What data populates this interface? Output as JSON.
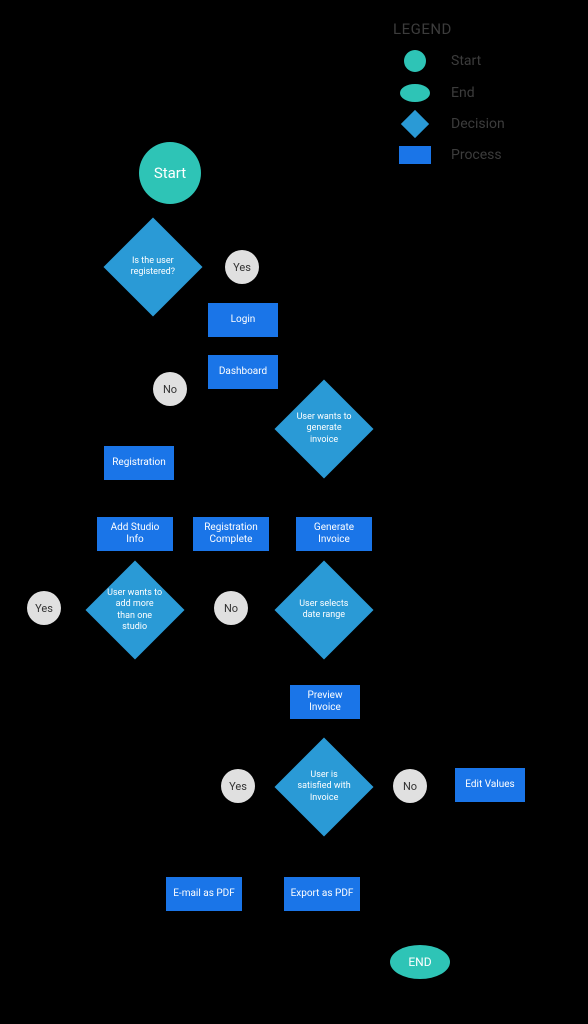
{
  "legend": {
    "title": "LEGEND",
    "items": [
      {
        "label": "Start"
      },
      {
        "label": "End"
      },
      {
        "label": "Decision"
      },
      {
        "label": "Process"
      }
    ]
  },
  "nodes": {
    "start": "Start",
    "d_registered": "Is the user registered?",
    "p_login": "Login",
    "p_dashboard": "Dashboard",
    "d_gen_invoice": "User wants to generate invoice",
    "p_registration": "Registration",
    "p_add_studio": "Add Studio Info",
    "p_reg_complete": "Registration Complete",
    "p_gen_invoice": "Generate Invoice",
    "d_more_studio": "User wants to add more than one studio",
    "d_date_range": "User selects date range",
    "p_preview": "Preview Invoice",
    "d_satisfied": "User is satisfied with Invoice",
    "p_edit_values": "Edit Values",
    "p_email_pdf": "E-mail as PDF",
    "p_export_pdf": "Export as PDF",
    "end": "END"
  },
  "badges": {
    "yes": "Yes",
    "no": "No"
  },
  "chart_data": {
    "type": "flowchart",
    "nodes": [
      {
        "id": "start",
        "type": "start",
        "label": "Start"
      },
      {
        "id": "d_registered",
        "type": "decision",
        "label": "Is the user registered?"
      },
      {
        "id": "p_login",
        "type": "process",
        "label": "Login"
      },
      {
        "id": "p_dashboard",
        "type": "process",
        "label": "Dashboard"
      },
      {
        "id": "d_gen_invoice",
        "type": "decision",
        "label": "User wants to generate invoice"
      },
      {
        "id": "p_registration",
        "type": "process",
        "label": "Registration"
      },
      {
        "id": "p_add_studio",
        "type": "process",
        "label": "Add Studio Info"
      },
      {
        "id": "p_reg_complete",
        "type": "process",
        "label": "Registration Complete"
      },
      {
        "id": "p_gen_invoice",
        "type": "process",
        "label": "Generate Invoice"
      },
      {
        "id": "d_more_studio",
        "type": "decision",
        "label": "User wants to add more than one studio"
      },
      {
        "id": "d_date_range",
        "type": "decision",
        "label": "User selects date range"
      },
      {
        "id": "p_preview",
        "type": "process",
        "label": "Preview Invoice"
      },
      {
        "id": "d_satisfied",
        "type": "decision",
        "label": "User is satisfied with Invoice"
      },
      {
        "id": "p_edit_values",
        "type": "process",
        "label": "Edit Values"
      },
      {
        "id": "p_email_pdf",
        "type": "process",
        "label": "E-mail as PDF"
      },
      {
        "id": "p_export_pdf",
        "type": "process",
        "label": "Export as PDF"
      },
      {
        "id": "end",
        "type": "end",
        "label": "END"
      }
    ],
    "edges": [
      {
        "from": "start",
        "to": "d_registered"
      },
      {
        "from": "d_registered",
        "to": "p_login",
        "label": "Yes"
      },
      {
        "from": "d_registered",
        "to": "p_registration",
        "label": "No"
      },
      {
        "from": "p_login",
        "to": "p_dashboard"
      },
      {
        "from": "p_dashboard",
        "to": "d_gen_invoice"
      },
      {
        "from": "p_registration",
        "to": "p_add_studio"
      },
      {
        "from": "p_add_studio",
        "to": "d_more_studio"
      },
      {
        "from": "d_more_studio",
        "to": "p_add_studio",
        "label": "Yes"
      },
      {
        "from": "d_more_studio",
        "to": "p_reg_complete",
        "label": "No"
      },
      {
        "from": "p_reg_complete",
        "to": "p_dashboard"
      },
      {
        "from": "d_gen_invoice",
        "to": "p_gen_invoice"
      },
      {
        "from": "p_gen_invoice",
        "to": "d_date_range"
      },
      {
        "from": "d_date_range",
        "to": "p_preview"
      },
      {
        "from": "p_preview",
        "to": "d_satisfied"
      },
      {
        "from": "d_satisfied",
        "to": "p_email_pdf",
        "label": "Yes"
      },
      {
        "from": "d_satisfied",
        "to": "p_export_pdf",
        "label": "Yes"
      },
      {
        "from": "d_satisfied",
        "to": "p_edit_values",
        "label": "No"
      },
      {
        "from": "p_edit_values",
        "to": "d_date_range"
      },
      {
        "from": "p_email_pdf",
        "to": "end"
      },
      {
        "from": "p_export_pdf",
        "to": "end"
      }
    ]
  }
}
